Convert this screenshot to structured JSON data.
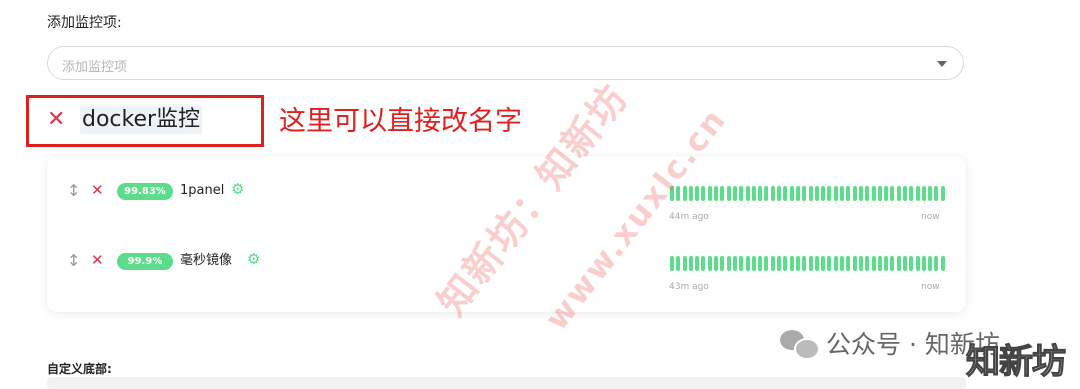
{
  "add_monitor": {
    "label": "添加监控项:",
    "placeholder": "添加监控项"
  },
  "group": {
    "name": "docker监控",
    "annotation": "这里可以直接改名字"
  },
  "monitors": [
    {
      "uptime": "99.83%",
      "name": "1panel",
      "ago": "44m ago",
      "now": "now",
      "beats_up": 44
    },
    {
      "uptime": "99.9%",
      "name": "毫秒镜像",
      "ago": "43m ago",
      "now": "now",
      "beats_up": 44
    }
  ],
  "watermark": {
    "line1": "知新坊：知新坊",
    "line2": "www.xuxlc.cn"
  },
  "wechat": {
    "text": "公众号 · 知新坊",
    "big": "知新坊"
  },
  "footer": {
    "label": "自定义底部:"
  },
  "colors": {
    "up": "#5cdd8b",
    "danger": "#dc3545",
    "annotation": "#e0201f"
  },
  "icons": {
    "drag": "drag-handle-icon",
    "delete": "delete-x-icon",
    "settings": "gear-icon",
    "dropdown": "caret-down-icon"
  }
}
